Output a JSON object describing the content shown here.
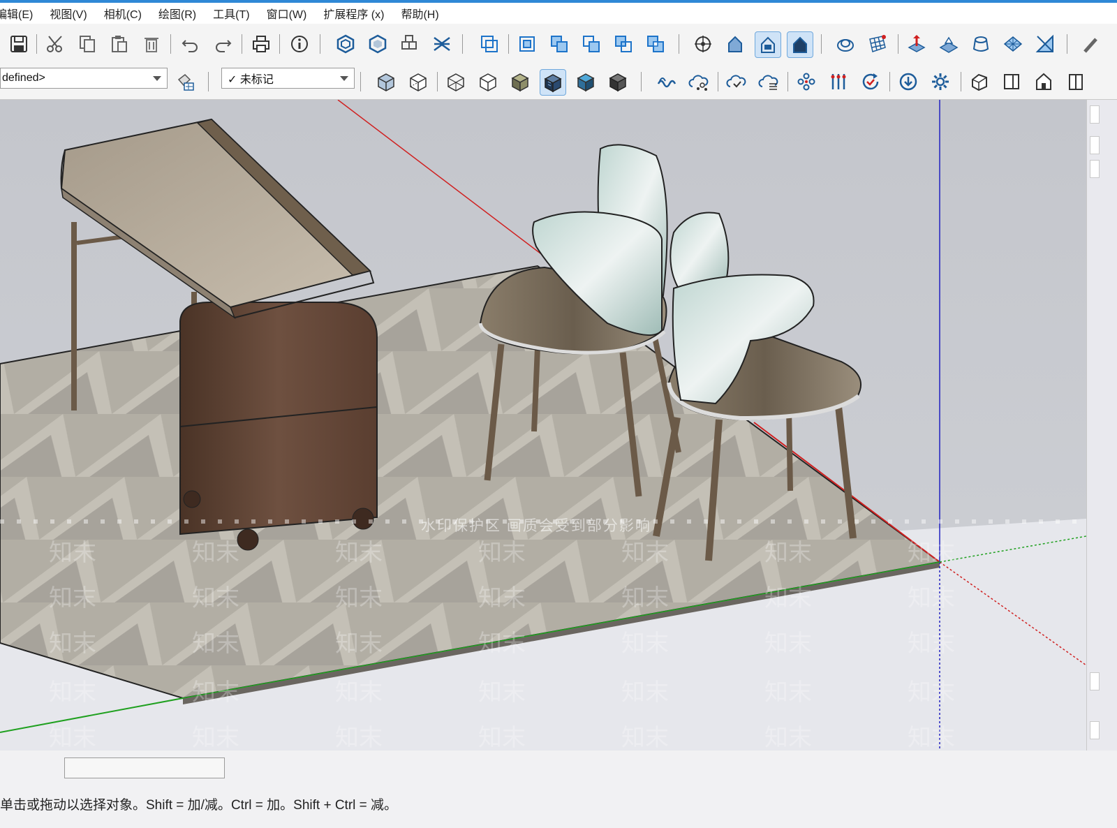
{
  "menu": [
    "编辑(E)",
    "视图(V)",
    "相机(C)",
    "绘图(R)",
    "工具(T)",
    "窗口(W)",
    "扩展程序 (x)",
    "帮助(H)"
  ],
  "toolbar2": {
    "style_dropdown": "defined>",
    "tag_dropdown": "✓ 未标记"
  },
  "viewport": {
    "watermark": "水印保护区   画质会受到部分影响",
    "watermark_tile": "知末"
  },
  "statusbar": {
    "measurements_value": "",
    "hint": "单击或拖动以选择对象。Shift = 加/减。Ctrl = 加。Shift + Ctrl = 减。"
  },
  "colors": {
    "accent": "#2f88d6",
    "sky": "#c9cbd1",
    "ground": "#ecedf1",
    "axis_red": "#d02020",
    "axis_green": "#1fa01f",
    "axis_blue": "#2020c0"
  }
}
